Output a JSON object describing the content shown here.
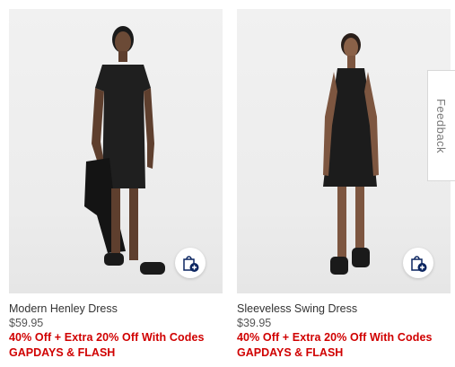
{
  "products": [
    {
      "name": "Modern Henley Dress",
      "price": "$59.95",
      "promo": "40% Off + Extra 20% Off With Codes",
      "codes": "GAPDAYS & FLASH"
    },
    {
      "name": "Sleeveless Swing Dress",
      "price": "$39.95",
      "promo": "40% Off + Extra 20% Off With Codes",
      "codes": "GAPDAYS & FLASH"
    }
  ],
  "feedback": {
    "label": "Feedback"
  },
  "colors": {
    "promo": "#d00000",
    "text": "#333333",
    "icon_badge": "#0b2560"
  },
  "icons": {
    "quick_add": "shopping-bag-plus-icon"
  }
}
